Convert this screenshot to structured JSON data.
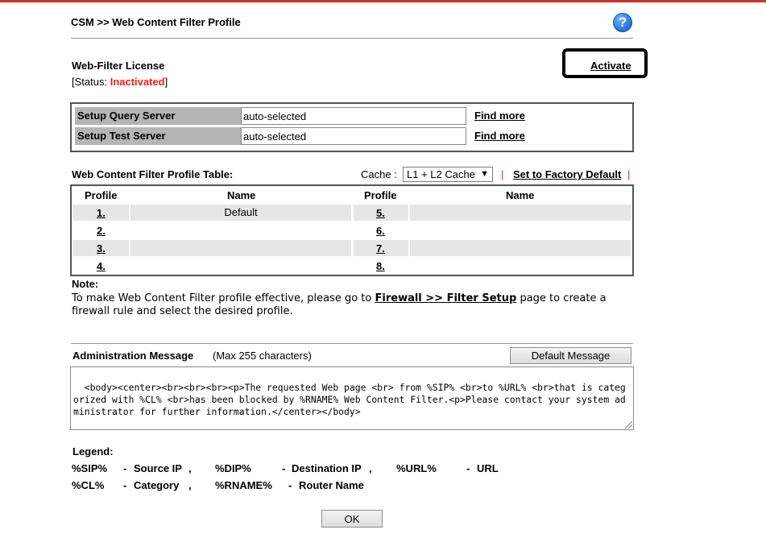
{
  "breadcrumb": "CSM >> Web Content Filter Profile",
  "help_icon": "?",
  "license": {
    "title": "Web-Filter License",
    "status_prefix": "[Status: ",
    "status_value": "Inactivated",
    "status_suffix": "]",
    "status_color": "#e8201a",
    "activate_label": "Activate"
  },
  "servers": [
    {
      "label": "Setup Query Server",
      "value": "auto-selected",
      "link": "Find more"
    },
    {
      "label": "Setup Test Server",
      "value": "auto-selected",
      "link": "Find more"
    }
  ],
  "profile_table": {
    "title": "Web Content Filter Profile Table:",
    "cache_label": "Cache :",
    "cache_value": "L1 + L2 Cache",
    "separator": "|",
    "factory_default_label": "Set to Factory Default",
    "headers": {
      "profile": "Profile",
      "name": "Name"
    },
    "left": [
      {
        "profile": "1.",
        "name": "Default"
      },
      {
        "profile": "2.",
        "name": ""
      },
      {
        "profile": "3.",
        "name": ""
      },
      {
        "profile": "4.",
        "name": ""
      }
    ],
    "right": [
      {
        "profile": "5.",
        "name": ""
      },
      {
        "profile": "6.",
        "name": ""
      },
      {
        "profile": "7.",
        "name": ""
      },
      {
        "profile": "8.",
        "name": ""
      }
    ]
  },
  "note": {
    "title": "Note:",
    "text_before": "To make Web Content Filter profile effective, please go to ",
    "link": "Firewall >> Filter Setup",
    "text_after": " page to create a",
    "text_line2": "firewall rule and select the desired profile."
  },
  "admin_message": {
    "title": "Administration Message",
    "max_hint": "(Max 255 characters)",
    "default_button": "Default Message",
    "value": "<body><center><br><br><br><p>The requested Web page <br> from %SIP% <br>to %URL% <br>that is categorized with %CL% <br>has been blocked by %RNAME% Web Content Filter.<p>Please contact your system administrator for further information.</center></body>"
  },
  "legend": {
    "title": "Legend:",
    "row1": [
      {
        "key": "%SIP%",
        "dash": "-",
        "desc": "Source IP",
        "sep": ","
      },
      {
        "key": "%DIP%",
        "dash": "-",
        "desc": "Destination IP",
        "sep": ","
      },
      {
        "key": "%URL%",
        "dash": "-",
        "desc": "URL",
        "sep": ""
      }
    ],
    "row2": [
      {
        "key": "%CL%",
        "dash": "-",
        "desc": "Category",
        "sep": ","
      },
      {
        "key": "%RNAME%",
        "dash": "-",
        "desc": "Router Name",
        "sep": ""
      }
    ]
  },
  "ok_label": "OK"
}
